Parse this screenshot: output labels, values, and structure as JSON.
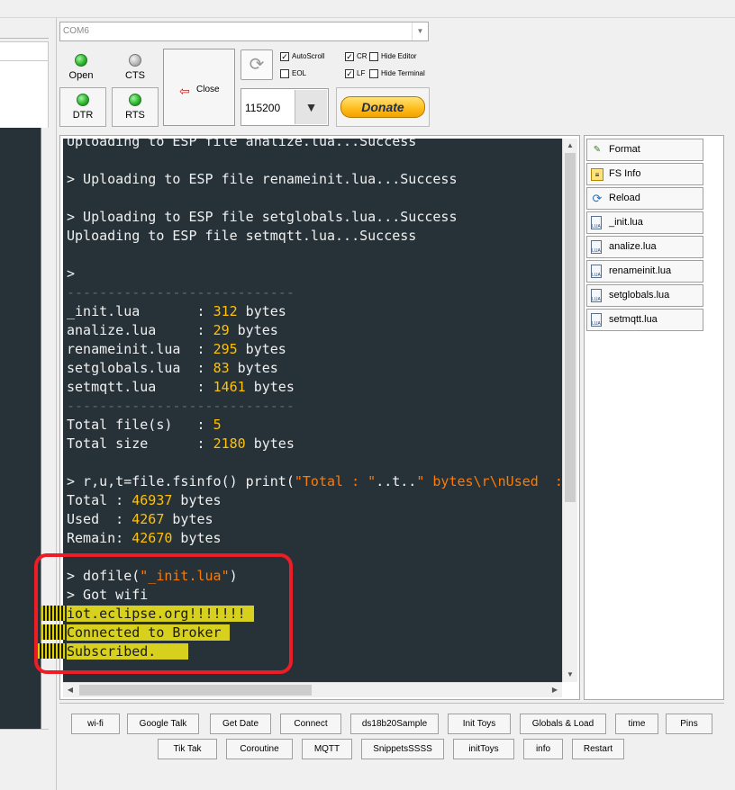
{
  "port": {
    "selected": "COM6"
  },
  "leds": {
    "open": "Open",
    "cts": "CTS",
    "dtr": "DTR",
    "rts": "RTS"
  },
  "close_label": "Close",
  "checkboxes": {
    "autoscroll": {
      "label": "AutoScroll",
      "checked": true
    },
    "eol": {
      "label": "EOL",
      "checked": false
    },
    "cr": {
      "label": "CR",
      "checked": true
    },
    "lf": {
      "label": "LF",
      "checked": true
    },
    "hide_editor": {
      "label": "Hide Editor",
      "checked": false
    },
    "hide_terminal": {
      "label": "Hide Terminal",
      "checked": false
    }
  },
  "baud": "115200",
  "donate": "Donate",
  "icons": {
    "refresh": "refresh-icon",
    "close": "disconnect-plug-icon",
    "format": "format-icon",
    "fsinfo": "fs-info-icon",
    "reload": "reload-icon",
    "lua_file": "lua-file-icon"
  },
  "colors": {
    "terminal_bg": "#263238",
    "terminal_text": "#f0f0f0",
    "number": "#ffc107",
    "string": "#ff7a00",
    "highlight": "#d7d01c",
    "annotation": "#ee1c25"
  },
  "terminal": {
    "l0": "Uploading to ESP file analize.lua...Success",
    "l2": "> Uploading to ESP file renameinit.lua...Success",
    "l4": "> Uploading to ESP file setglobals.lua...Success",
    "l5": "Uploading to ESP file setmqtt.lua...Success",
    "l7": ">",
    "sep": "----------------------------",
    "files": [
      {
        "name": "_init.lua       : ",
        "size": "312",
        "unit": " bytes"
      },
      {
        "name": "analize.lua     : ",
        "size": "29",
        "unit": " bytes"
      },
      {
        "name": "renameinit.lua  : ",
        "size": "295",
        "unit": " bytes"
      },
      {
        "name": "setglobals.lua  : ",
        "size": "83",
        "unit": " bytes"
      },
      {
        "name": "setmqtt.lua     : ",
        "size": "1461",
        "unit": " bytes"
      }
    ],
    "total_files_label": "Total file(s)   : ",
    "total_files": "5",
    "total_size_label": "Total size      : ",
    "total_size": "2180",
    "total_size_unit": " bytes",
    "cmd_a": "> r,u,t=file.fsinfo() print(",
    "cmd_str1": "\"Total : \"",
    "cmd_b": "..t..",
    "cmd_str2": "\" bytes\\r\\nUsed  :",
    "info_total_label": "Total : ",
    "info_total": "46937",
    "info_used_label": "Used  : ",
    "info_used": "4267",
    "info_remain_label": "Remain: ",
    "info_remain": "42670",
    "bytes": " bytes",
    "dofile_a": "> dofile(",
    "dofile_str": "\"_init.lua\"",
    "dofile_b": ")",
    "got_wifi": "> Got wifi",
    "hl1": "iot.eclipse.org!!!!!!! ",
    "hl2": "Connected to Broker ",
    "hl3": "Subscribed.    "
  },
  "sidebar": [
    {
      "label": "Format"
    },
    {
      "label": "FS Info"
    },
    {
      "label": "Reload"
    },
    {
      "label": "_init.lua"
    },
    {
      "label": "analize.lua"
    },
    {
      "label": "renameinit.lua"
    },
    {
      "label": "setglobals.lua"
    },
    {
      "label": "setmqtt.lua"
    }
  ],
  "snippets": [
    "wi-fi",
    "Google Talk",
    "Get Date",
    "Connect",
    "ds18b20Sample",
    "Init Toys",
    "Globals & Load",
    "time",
    "Pins",
    "Tik Tak",
    "Coroutine",
    "MQTT",
    "SnippetsSSSS",
    "initToys",
    "info",
    "Restart"
  ]
}
